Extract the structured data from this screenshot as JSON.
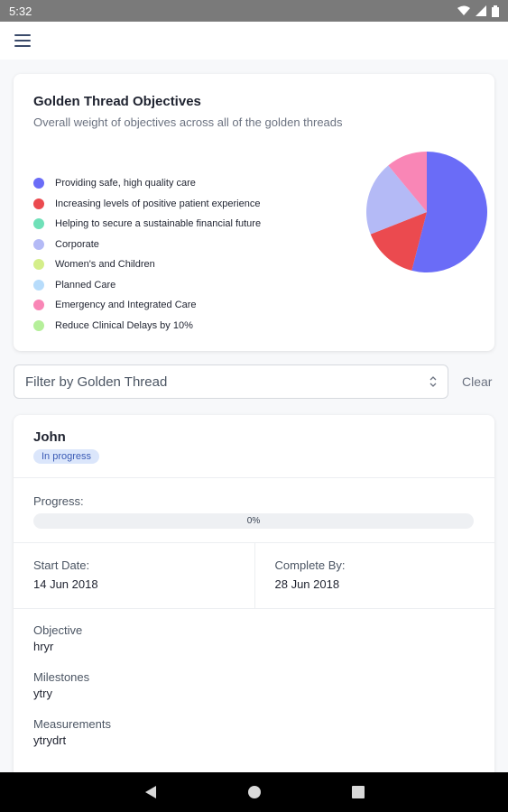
{
  "status_bar": {
    "time": "5:32"
  },
  "app_bar": {
    "menu_icon": "menu-icon"
  },
  "chart_card": {
    "title": "Golden Thread Objectives",
    "subtitle": "Overall weight of objectives across all of the golden threads"
  },
  "chart_data": {
    "type": "pie",
    "legend_placement": "left",
    "labels": [
      "Providing safe, high quality care",
      "Increasing levels of positive patient experience",
      "Helping to secure a sustainable financial future",
      "Corporate",
      "Women's and Children",
      "Planned Care",
      "Emergency and Integrated Care",
      "Reduce Clinical Delays by 10%"
    ],
    "colors": [
      "#6a6cf7",
      "#eb4a4f",
      "#6fe0b8",
      "#b4baf6",
      "#d4ee8a",
      "#b7dcfb",
      "#f986b6",
      "#b5ef9a"
    ],
    "values": [
      54,
      15,
      0,
      20,
      0,
      0,
      11,
      0
    ]
  },
  "filter": {
    "placeholder": "Filter by Golden Thread",
    "clear_label": "Clear"
  },
  "item": {
    "name": "John",
    "status": "In progress",
    "progress_label": "Progress:",
    "progress_value": 0,
    "progress_text": "0%",
    "start_label": "Start Date:",
    "start_value": "14 Jun 2018",
    "complete_label": "Complete By:",
    "complete_value": "28 Jun 2018",
    "objective_label": "Objective",
    "objective_value": "hryr",
    "milestones_label": "Milestones",
    "milestones_value": "ytry",
    "measurements_label": "Measurements",
    "measurements_value": "ytrydrt"
  }
}
